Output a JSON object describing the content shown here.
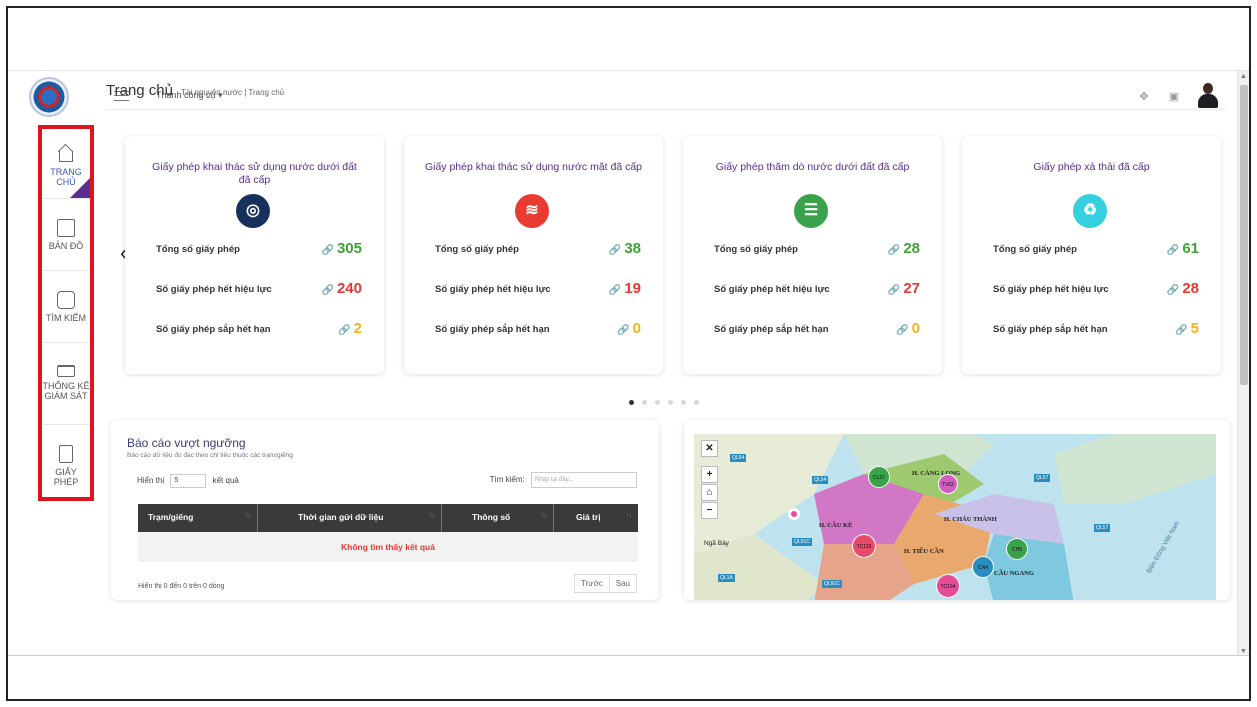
{
  "sidebar": {
    "items": [
      {
        "label": "TRANG CHỦ",
        "icon": "home-icon"
      },
      {
        "label": "BẢN ĐỒ",
        "icon": "map-icon"
      },
      {
        "label": "TÌM KIẾM",
        "icon": "search-icon"
      },
      {
        "label": "THỐNG KÊ GIÁM SÁT",
        "icon": "statistics-icon"
      },
      {
        "label": "GIẤY PHÉP",
        "icon": "license-icon"
      }
    ]
  },
  "topbar": {
    "toolbar_menu": "Thanh công cụ ▾"
  },
  "page": {
    "title": "Trang chủ",
    "crumb": "Tài nguyên nước | Trang chủ"
  },
  "cards": [
    {
      "title": "Giấy phép khai thác sử dụng nước dưới đất đã cấp",
      "icon": "◎",
      "color": "#16325c",
      "total_label": "Tổng số giấy phép",
      "total": "305",
      "expired_label": "Số giấy phép hết hiệu lực",
      "expired": "240",
      "expiring_label": "Số giấy phép sắp hết hạn",
      "expiring": "2"
    },
    {
      "title": "Giấy phép khai thác sử dụng nước mặt đã cấp",
      "icon": "≋",
      "color": "#ea3b32",
      "total_label": "Tổng số giấy phép",
      "total": "38",
      "expired_label": "Số giấy phép hết hiệu lực",
      "expired": "19",
      "expiring_label": "Số giấy phép sắp hết hạn",
      "expiring": "0"
    },
    {
      "title": "Giấy phép thăm dò nước dưới đất đã cấp",
      "icon": "☰",
      "color": "#3aa24a",
      "total_label": "Tổng số giấy phép",
      "total": "28",
      "expired_label": "Số giấy phép hết hiệu lực",
      "expired": "27",
      "expiring_label": "Số giấy phép sắp hết hạn",
      "expiring": "0"
    },
    {
      "title": "Giấy phép xả thải đã cấp",
      "icon": "♻",
      "color": "#35d0e0",
      "total_label": "Tổng số giấy phép",
      "total": "61",
      "expired_label": "Số giấy phép hết hiệu lực",
      "expired": "28",
      "expiring_label": "Số giấy phép sắp hết hạn",
      "expiring": "5"
    }
  ],
  "carousel": {
    "prev": "‹",
    "next": "›",
    "dots": 6,
    "active_dot": 0
  },
  "report": {
    "title": "Báo cáo vượt ngưỡng",
    "subtitle": "Báo cáo dữ liệu đo đạc theo chỉ tiêu thuộc các trạm/giếng",
    "show_label": "Hiển thị",
    "page_size": "5",
    "result_label": "kết quả",
    "search_label": "Tìm kiếm:",
    "search_placeholder": "Nhập tại đây...",
    "columns": [
      "Trạm/giếng",
      "Thời gian gửi dữ liệu",
      "Thông số",
      "Giá trị"
    ],
    "empty_text": "Không tìm thấy kết quả",
    "footer": "Hiển thị 0 đến 0 trên 0 dòng",
    "prev": "Trước",
    "next": "Sau"
  },
  "map": {
    "labels": [
      "H. CÀNG LONG",
      "H. CẦU KÈ",
      "H. CHÂU THÀNH",
      "H. TIỂU CẦN",
      "CẦU NGANG",
      "Ngã Bảy",
      "Biển Đông Việt Nam"
    ],
    "badges": [
      "QL54",
      "QL54",
      "QL57",
      "QL57",
      "QL91C",
      "QL1A",
      "QL91C"
    ],
    "circles": [
      "CL37",
      "TV02",
      "TC110",
      "CH5",
      "CN4",
      "TC194"
    ]
  }
}
